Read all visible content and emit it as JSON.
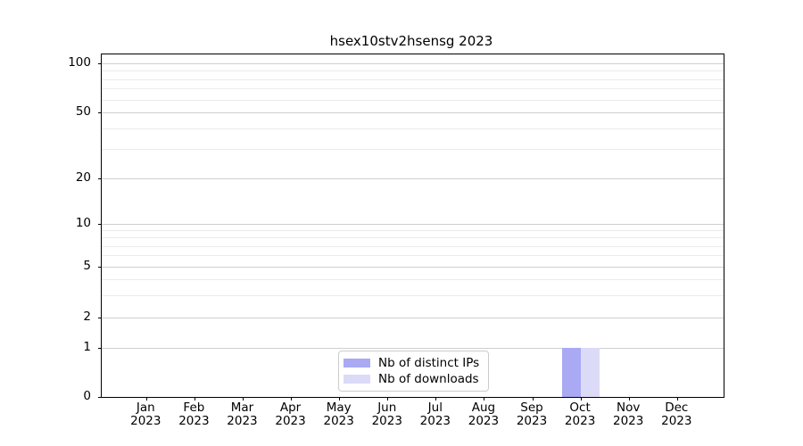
{
  "title": "hsex10stv2hsensg 2023",
  "chart_data": {
    "type": "bar",
    "title": "hsex10stv2hsensg 2023",
    "categories": [
      "Jan 2023",
      "Feb 2023",
      "Mar 2023",
      "Apr 2023",
      "May 2023",
      "Jun 2023",
      "Jul 2023",
      "Aug 2023",
      "Sep 2023",
      "Oct 2023",
      "Nov 2023",
      "Dec 2023"
    ],
    "series": [
      {
        "name": "Nb of distinct IPs",
        "color": "#a9a9f4",
        "values": [
          0,
          0,
          0,
          0,
          0,
          0,
          0,
          0,
          0,
          1,
          0,
          0
        ]
      },
      {
        "name": "Nb of downloads",
        "color": "#dbdbf7",
        "values": [
          0,
          0,
          0,
          0,
          0,
          0,
          0,
          0,
          0,
          1,
          0,
          0
        ]
      }
    ],
    "y_major_ticks": [
      0,
      1,
      2,
      5,
      10,
      20,
      50,
      100
    ],
    "y_minor_gridlines": [
      3,
      4,
      6,
      7,
      8,
      9,
      30,
      40,
      60,
      70,
      80,
      90
    ],
    "y_scale": "symlog",
    "ylim": [
      0,
      110
    ],
    "xlabel": "",
    "ylabel": "",
    "grid": "horizontal",
    "legend_position": "lower-center"
  },
  "colors": {
    "major_grid": "#cfcfcf",
    "minor_grid": "#ebebeb",
    "spine": "#000000",
    "legend_border": "#cccccc",
    "background": "#ffffff"
  }
}
